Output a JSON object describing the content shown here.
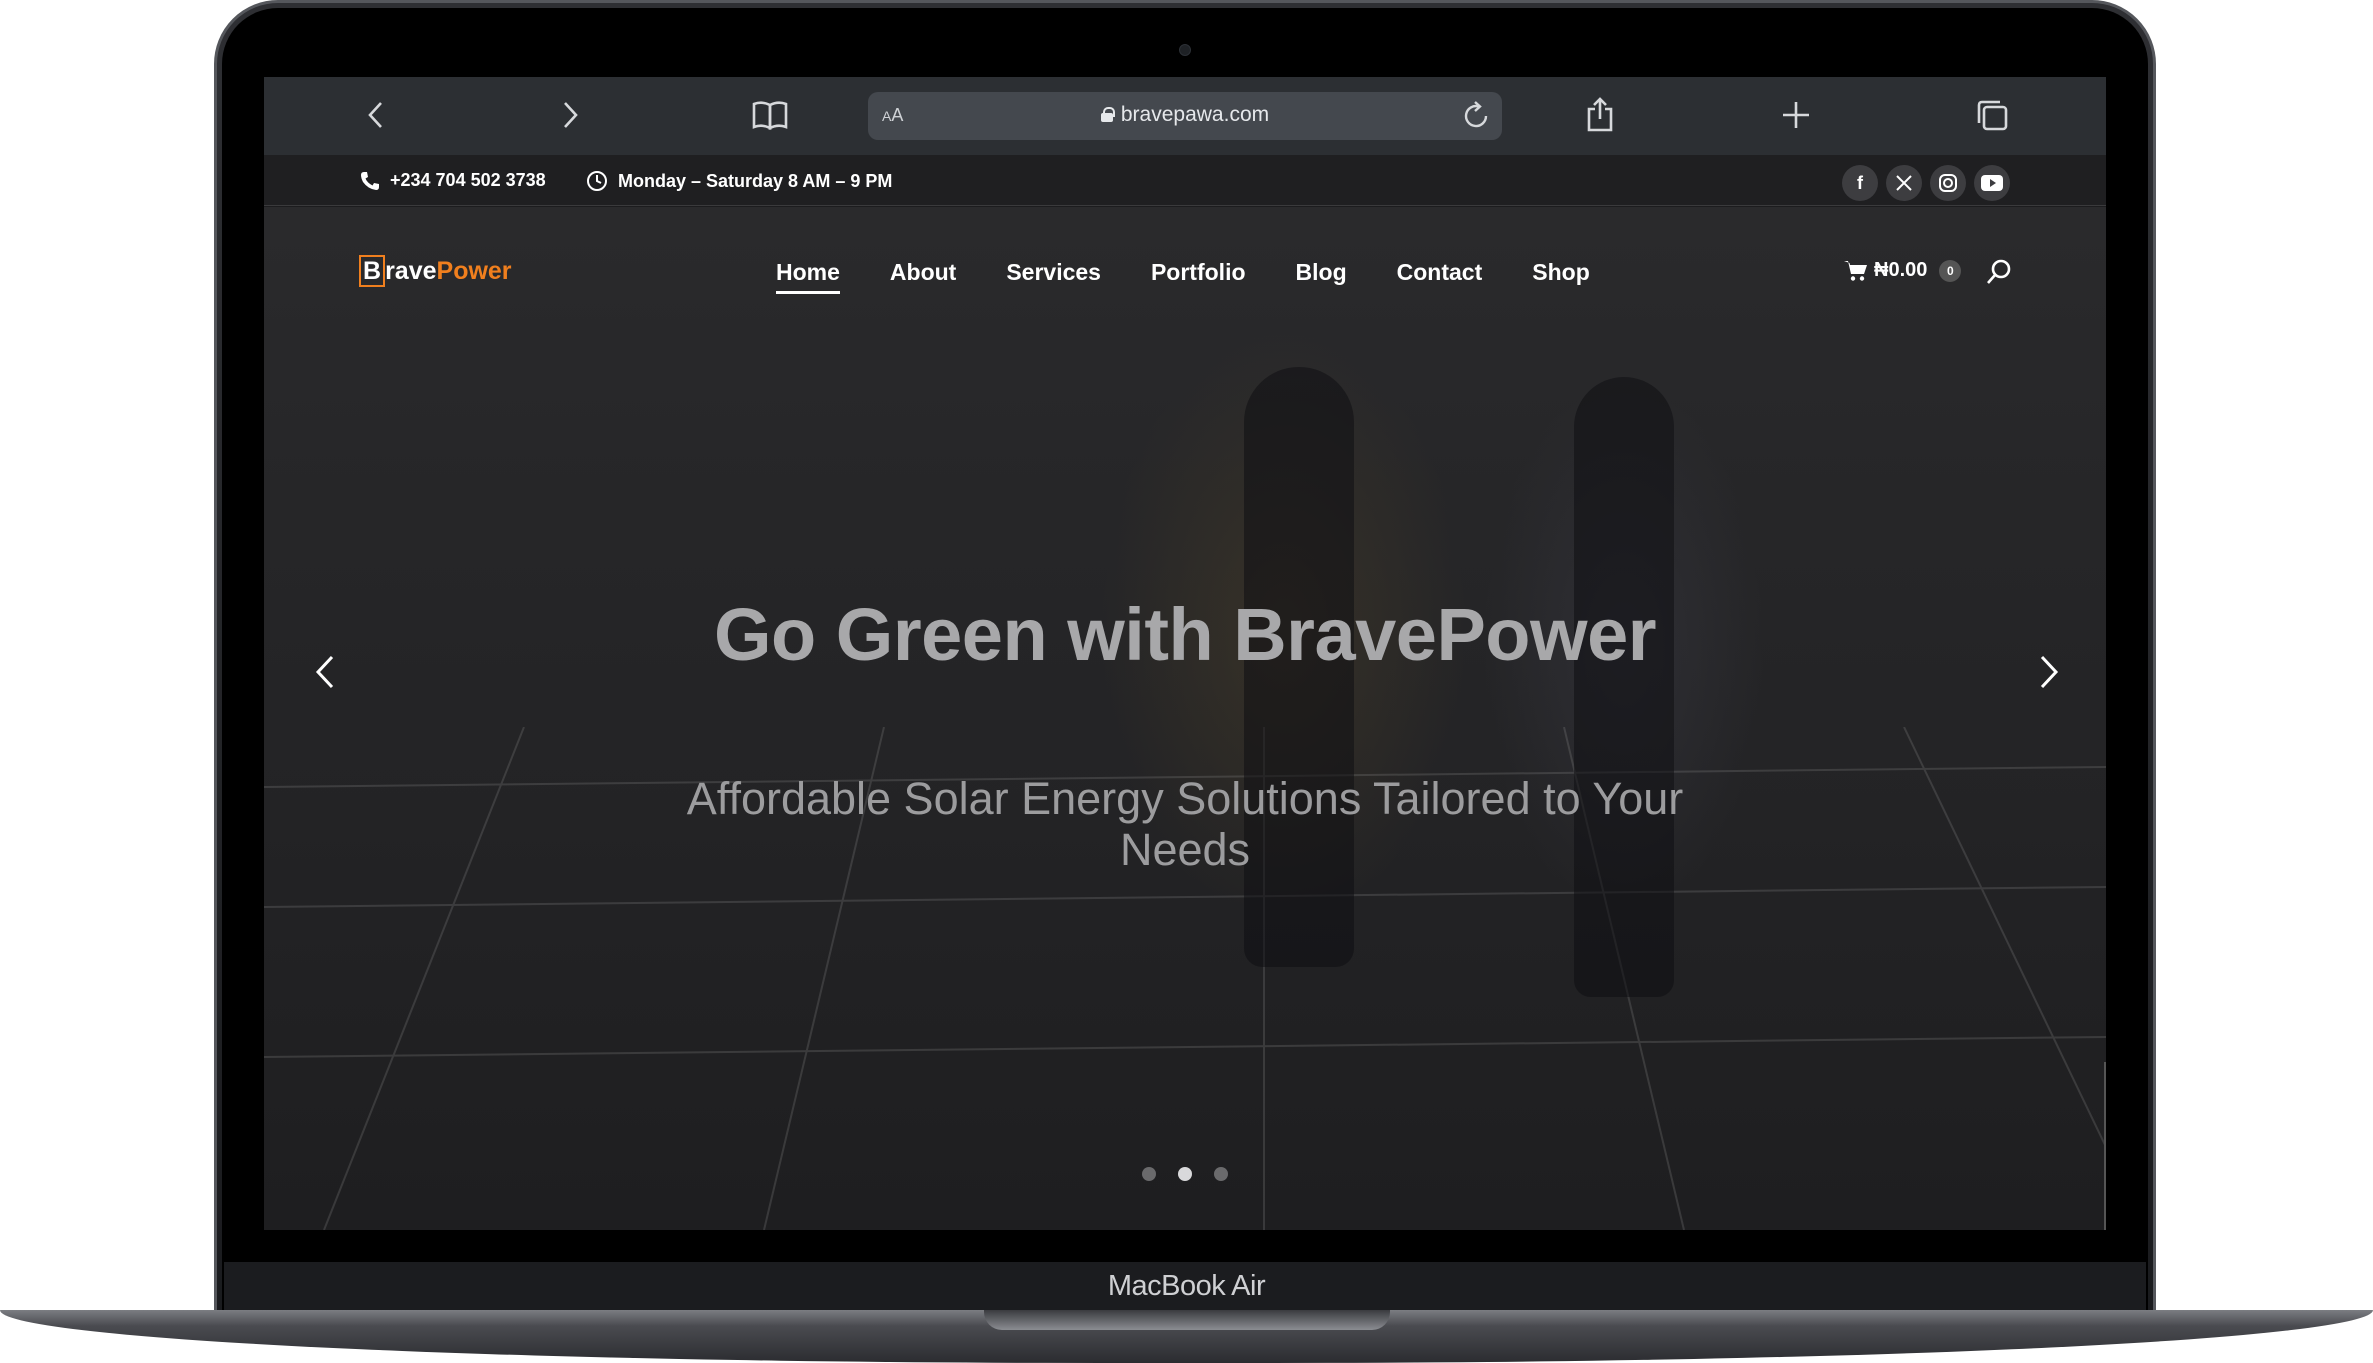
{
  "browser": {
    "text_size_label": "AA",
    "url": "bravepawa.com"
  },
  "topbar": {
    "phone": "+234 704 502 3738",
    "hours": "Monday – Saturday 8 AM – 9 PM",
    "socials": [
      "facebook-icon",
      "x-twitter-icon",
      "instagram-icon",
      "youtube-icon"
    ]
  },
  "brand": {
    "logo_b": "B",
    "logo_rave": "rave",
    "logo_power": "Power",
    "accent_color": "#f07f1e"
  },
  "nav": {
    "items": [
      "Home",
      "About",
      "Services",
      "Portfolio",
      "Blog",
      "Contact",
      "Shop"
    ],
    "active": "Home"
  },
  "cart": {
    "total": "₦0.00",
    "count": "0"
  },
  "hero": {
    "title": "Go Green with BravePower",
    "subtitle": "Affordable Solar Energy Solutions Tailored to Your Needs",
    "slide_count": 3,
    "active_slide": 2
  },
  "device": {
    "label": "MacBook Air"
  }
}
